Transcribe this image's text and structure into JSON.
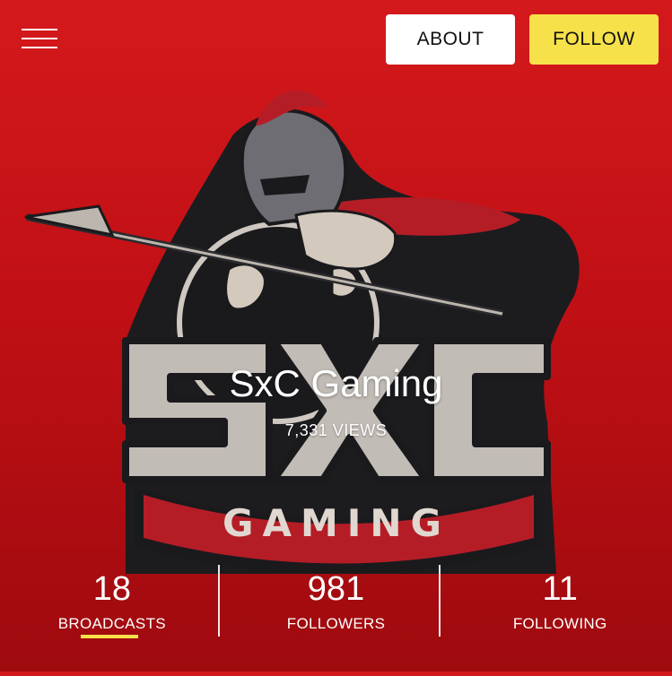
{
  "header": {
    "menu_icon": "hamburger-menu-icon",
    "about_label": "ABOUT",
    "follow_label": "FOLLOW"
  },
  "channel": {
    "name": "SxC Gaming",
    "views": "7,331 VIEWS",
    "logo": {
      "wordmark": "SxC",
      "subword": "GAMING"
    }
  },
  "stats": [
    {
      "count": "18",
      "label": "BROADCASTS",
      "active": true
    },
    {
      "count": "981",
      "label": "FOLLOWERS",
      "active": false
    },
    {
      "count": "11",
      "label": "FOLLOWING",
      "active": false
    }
  ],
  "colors": {
    "background": "#c01015",
    "follow_button": "#f7e14a",
    "about_button": "#ffffff",
    "active_tab_underline": "#f7e14a"
  }
}
